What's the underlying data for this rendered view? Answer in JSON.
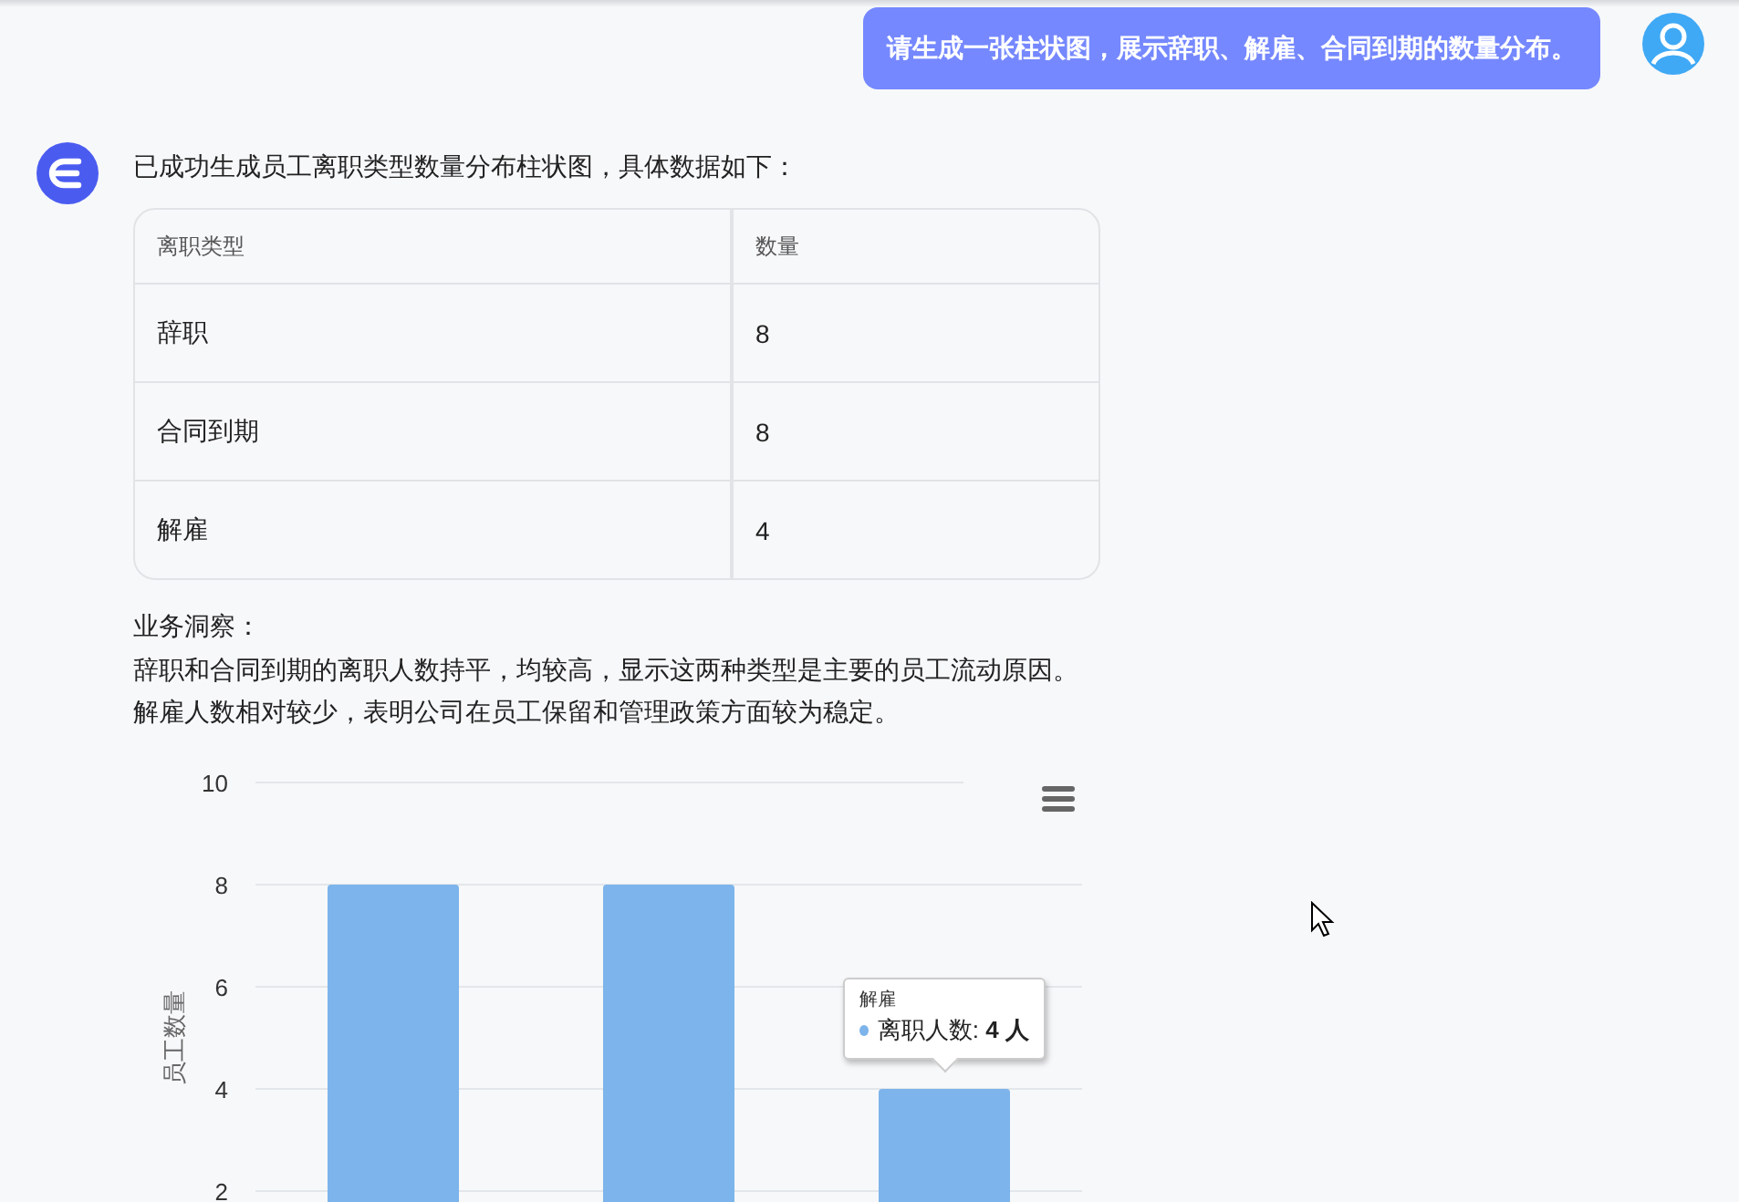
{
  "user_message": {
    "text": "请生成一张柱状图，展示辞职、解雇、合同到期的数量分布。"
  },
  "reply": {
    "intro": "已成功生成员工离职类型数量分布柱状图，具体数据如下：",
    "table": {
      "columns": [
        "离职类型",
        "数量"
      ],
      "rows": [
        [
          "辞职",
          "8"
        ],
        [
          "合同到期",
          "8"
        ],
        [
          "解雇",
          "4"
        ]
      ]
    },
    "insight_title": "业务洞察：",
    "insights": [
      "辞职和合同到期的离职人数持平，均较高，显示这两种类型是主要的员工流动原因。",
      "解雇人数相对较少，表明公司在员工保留和管理政策方面较为稳定。"
    ],
    "chart": {
      "chart_data": {
        "type": "bar",
        "ylabel": "员工数量",
        "series": [
          {
            "name": "离职人数",
            "color": "#7cb4eb",
            "values": [
              8,
              8,
              4
            ]
          }
        ],
        "yticks": [
          2,
          4,
          6,
          8,
          10
        ],
        "ylim": [
          0,
          10
        ],
        "grid": true
      },
      "tooltip": {
        "title": "解雇",
        "separator": ":",
        "value": "4 人"
      }
    }
  }
}
